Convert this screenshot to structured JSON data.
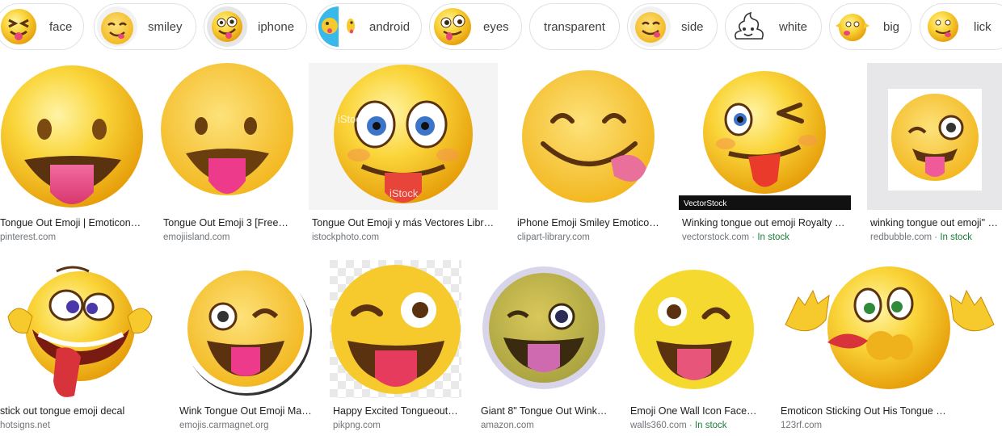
{
  "chips": [
    {
      "label": "face"
    },
    {
      "label": "smiley"
    },
    {
      "label": "iphone"
    },
    {
      "label": "android"
    },
    {
      "label": "eyes"
    },
    {
      "label": "transparent"
    },
    {
      "label": "side"
    },
    {
      "label": "white"
    },
    {
      "label": "big"
    },
    {
      "label": "lick"
    }
  ],
  "results": [
    {
      "title": "Tongue Out Emoji | Emoticon…",
      "source": "pinterest.com",
      "stock": ""
    },
    {
      "title": "Tongue Out Emoji 3 [Free…",
      "source": "emojiisland.com",
      "stock": ""
    },
    {
      "title": "Tongue Out Emoji y más Vectores Libr…",
      "source": "istockphoto.com",
      "stock": ""
    },
    {
      "title": "iPhone Emoji Smiley Emotico…",
      "source": "clipart-library.com",
      "stock": ""
    },
    {
      "title": "Winking tongue out emoji Royalty …",
      "source": "vectorstock.com",
      "stock": "In stock"
    },
    {
      "title": "winking tongue out emoji\" …",
      "source": "redbubble.com",
      "stock": "In stock"
    },
    {
      "title": "stick out tongue emoji decal",
      "source": "hotsigns.net",
      "stock": ""
    },
    {
      "title": "Wink Tongue Out Emoji Ma…",
      "source": "emojis.carmagnet.org",
      "stock": ""
    },
    {
      "title": "Happy Excited Tongueout…",
      "source": "pikpng.com",
      "stock": ""
    },
    {
      "title": "Giant 8\" Tongue Out Wink…",
      "source": "amazon.com",
      "stock": ""
    },
    {
      "title": "Emoji One Wall Icon Face…",
      "source": "walls360.com",
      "stock": "In stock"
    },
    {
      "title": "Emoticon Sticking Out His Tongue …",
      "source": "123rf.com",
      "stock": ""
    }
  ],
  "meta_separator": " · ",
  "overlay_text": {
    "watermark": "iStock",
    "vectorstock_brand": "VectorStock"
  },
  "colors": {
    "emoji_yellow": "#f6c92c",
    "tongue": "#e8457a",
    "mouth": "#5a3210",
    "in_stock": "#188038",
    "source_grey": "#70757a"
  }
}
